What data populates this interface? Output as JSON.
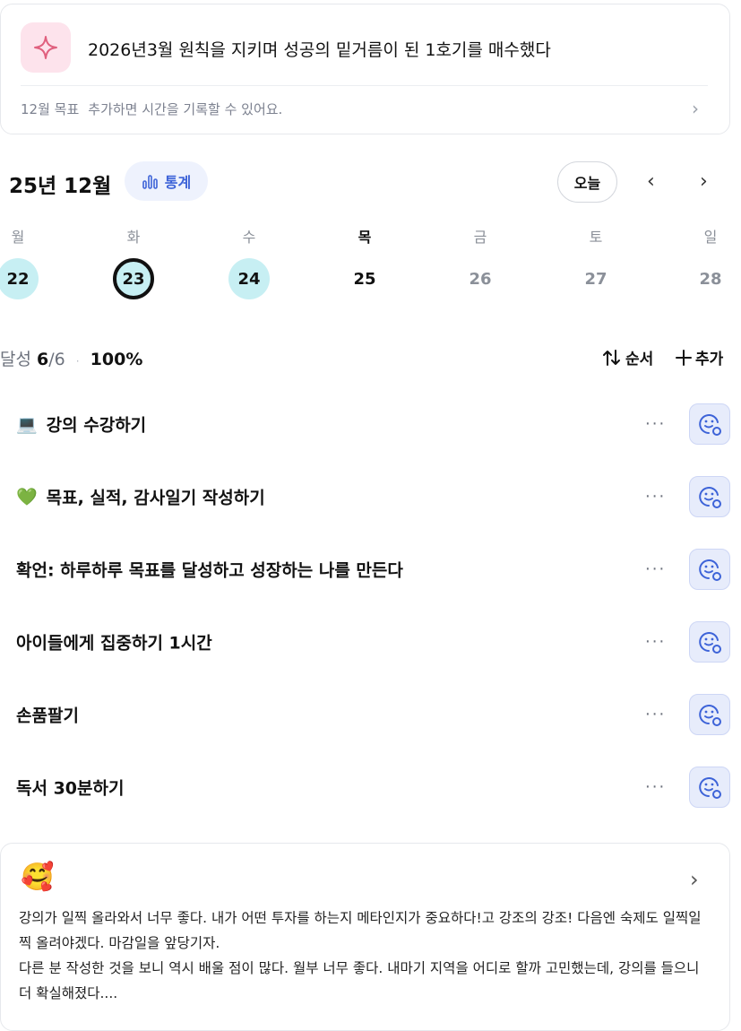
{
  "goal": {
    "title": "2026년3월 원칙을 지키며 성공의 밑거름이 된 1호기를 매수했다",
    "sub_label": "12월 목표",
    "sub_hint": "추가하면 시간을 기록할 수 있어요.",
    "icon": "sparkle-icon"
  },
  "calendar": {
    "month": "25년 12월",
    "stats_label": "통계",
    "today_label": "오늘",
    "days": [
      {
        "dow": "월",
        "num": "22",
        "state": "done"
      },
      {
        "dow": "화",
        "num": "23",
        "state": "selected"
      },
      {
        "dow": "수",
        "num": "24",
        "state": "done"
      },
      {
        "dow": "목",
        "num": "25",
        "state": "today"
      },
      {
        "dow": "금",
        "num": "26",
        "state": "future"
      },
      {
        "dow": "토",
        "num": "27",
        "state": "future"
      },
      {
        "dow": "일",
        "num": "28",
        "state": "future"
      }
    ]
  },
  "progress": {
    "label": "달성",
    "done": "6",
    "total": "/6",
    "percent": "100%"
  },
  "actions": {
    "sort_label": "순서",
    "add_label": "추가"
  },
  "tasks": [
    {
      "emoji": "💻",
      "title": "강의 수강하기"
    },
    {
      "emoji": "💚",
      "title": "목표, 실적, 감사일기 작성하기"
    },
    {
      "emoji": "",
      "title": "확언: 하루하루 목표를 달성하고 성장하는 나를 만든다"
    },
    {
      "emoji": "",
      "title": "아이들에게 집중하기 1시간"
    },
    {
      "emoji": "",
      "title": "손품팔기"
    },
    {
      "emoji": "",
      "title": "독서 30분하기"
    }
  ],
  "diary": {
    "emoji": "🥰",
    "text": "강의가 일찍 올라와서 너무 좋다. 내가 어떤 투자를 하는지 메타인지가 중요하다!고 강조의 강조! 다음엔 숙제도 일찍일찍 올려야겠다. 마감일을 앞당기자.\n다른 분 작성한 것을 보니 역시 배울 점이 많다. 월부 너무 좋다. 내마기 지역을 어디로 할까 고민했는데, 강의를 들으니 더 확실해졌다...."
  },
  "colors": {
    "accent_blue": "#3d63d8",
    "done_day_bg": "#c7eff3",
    "sparkle_bg": "#fde3ec"
  }
}
